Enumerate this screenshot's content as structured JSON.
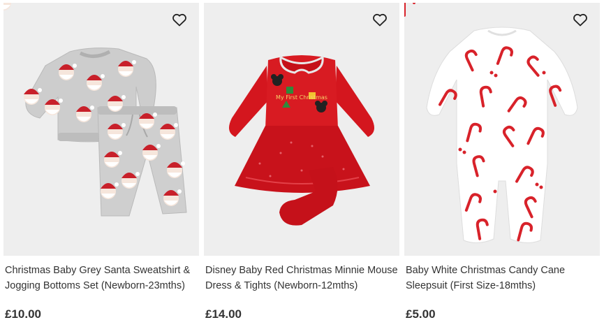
{
  "products": [
    {
      "title": "Christmas Baby Grey Santa Sweatshirt & Jogging Bottoms Set (Newborn-23mths)",
      "price": "£10.00",
      "icon": "heart-icon"
    },
    {
      "title": "Disney Baby Red Christmas Minnie Mouse Dress & Tights (Newborn-12mths)",
      "price": "£14.00",
      "icon": "heart-icon",
      "print_text": "My First Christmas"
    },
    {
      "title": "Baby White Christmas Candy Cane Sleepsuit (First Size-18mths)",
      "price": "£5.00",
      "icon": "heart-icon"
    }
  ],
  "colors": {
    "card_bg": "#eeeeee",
    "text": "#333333",
    "red_garment": "#d4161e",
    "grey_garment": "#c9c9c9"
  }
}
